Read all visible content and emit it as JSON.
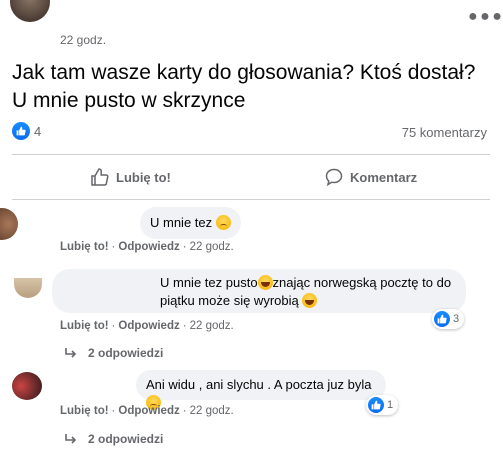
{
  "post": {
    "time": "22 godz.",
    "text": "Jak tam wasze karty do głosowania? Ktoś dostał? U mnie pusto w skrzynce",
    "reaction_count": "4",
    "comment_count": "75 komentarzy",
    "menu_icon": "more-horizontal-icon"
  },
  "actions": {
    "like_label": "Lubię to!",
    "comment_label": "Komentarz"
  },
  "comments": [
    {
      "text": "U mnie tez",
      "like_label": "Lubię to!",
      "reply_label": "Odpowiedz",
      "time": "22 godz."
    },
    {
      "text_part1": "U mnie tez pusto",
      "text_part2": "znając norwegską pocztę to do piątku może się wyrobią",
      "like_label": "Lubię to!",
      "reply_label": "Odpowiedz",
      "time": "22 godz.",
      "reaction_count": "3",
      "replies_label": "2 odpowiedzi"
    },
    {
      "text": "Ani widu , ani slychu . A poczta juz byla",
      "like_label": "Lubię to!",
      "reply_label": "Odpowiedz",
      "time": "22 godz.",
      "reaction_count": "1",
      "replies_label": "2 odpowiedzi"
    }
  ],
  "colors": {
    "accent": "#1877f2",
    "secondary_text": "#65676b",
    "bubble_bg": "#f0f2f5"
  }
}
